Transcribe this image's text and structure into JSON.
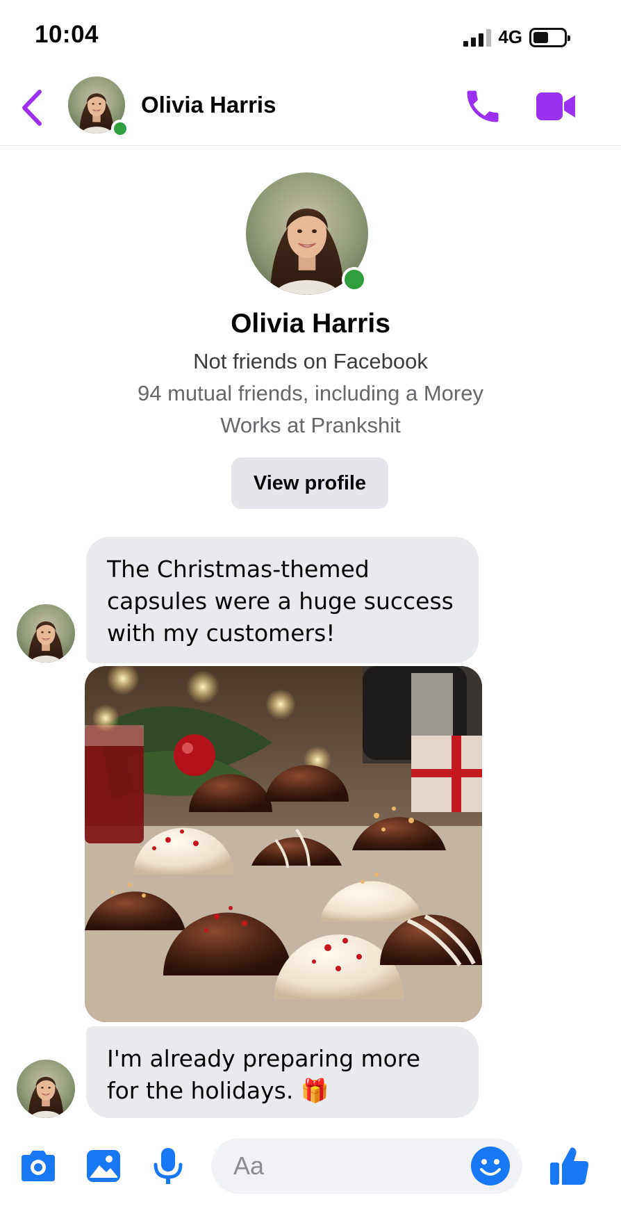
{
  "status_bar": {
    "time": "10:04",
    "network": "4G",
    "battery_level": 0.5
  },
  "header": {
    "contact_name": "Olivia Harris",
    "online": true
  },
  "profile": {
    "name": "Olivia Harris",
    "relationship": "Not friends on Facebook",
    "mutual_friends": "94 mutual friends, including a Morey",
    "work": "Works at Prankshit",
    "view_profile_label": "View profile"
  },
  "messages": [
    {
      "text": "The Christmas-themed capsules were a huge success with my customers!"
    },
    {
      "type": "photo",
      "subject": "chocolate-capsules-photo"
    },
    {
      "text": "I'm already preparing more for the holidays. 🎁"
    }
  ],
  "composer": {
    "placeholder": "Aa"
  },
  "colors": {
    "accent_purple": "#9b30ef",
    "accent_blue": "#1877f2",
    "online_green": "#2e9e3f",
    "bubble_gray": "#e9eaed"
  },
  "icons": [
    "chevron-left-icon",
    "phone-icon",
    "video-camera-icon",
    "camera-icon",
    "image-icon",
    "microphone-icon",
    "smile-emoji-icon",
    "thumbs-up-icon"
  ]
}
